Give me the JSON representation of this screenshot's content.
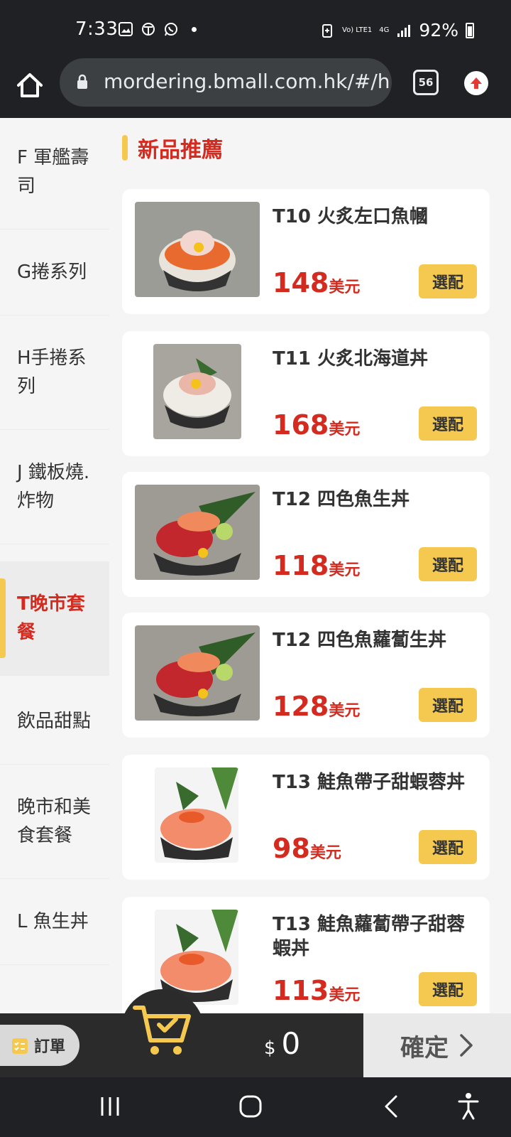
{
  "status_bar": {
    "time": "7:33",
    "network_top": "Vo) LTE1",
    "network_gen": "4G",
    "battery": "92%"
  },
  "browser": {
    "url": "mordering.bmall.com.hk/#/h",
    "tab_count": "56"
  },
  "sidebar": {
    "items": [
      {
        "label": "F 軍艦壽司"
      },
      {
        "label": "G捲系列"
      },
      {
        "label": "H手捲系列"
      },
      {
        "label": "J 鐵板燒.炸物"
      },
      {
        "label": "T晚市套餐"
      },
      {
        "label": "飲品甜點"
      },
      {
        "label": "晚市和美食套餐"
      },
      {
        "label": "L 魚生丼"
      }
    ],
    "active_index": 4
  },
  "section": {
    "title": "新品推薦"
  },
  "products": [
    {
      "name": "T10 火炙左口魚幗",
      "price": "148",
      "unit": "美元",
      "select": "選配"
    },
    {
      "name": "T11 火炙北海道丼",
      "price": "168",
      "unit": "美元",
      "select": "選配"
    },
    {
      "name": "T12 四色魚生丼",
      "price": "118",
      "unit": "美元",
      "select": "選配"
    },
    {
      "name": "T12 四色魚蘿蔔生丼",
      "price": "128",
      "unit": "美元",
      "select": "選配"
    },
    {
      "name": "T13 鮭魚帶子甜蝦蓉丼",
      "price": "98",
      "unit": "美元",
      "select": "選配"
    },
    {
      "name": "T13 鮭魚蘿蔔帶子甜蓉蝦丼",
      "price": "113",
      "unit": "美元",
      "select": "選配"
    }
  ],
  "bottom": {
    "order_label": "訂單",
    "currency_symbol": "$",
    "total": "0",
    "confirm_label": "確定"
  },
  "colors": {
    "accent_red": "#d32b1f",
    "accent_yellow": "#f5c950",
    "dark": "#202124"
  }
}
